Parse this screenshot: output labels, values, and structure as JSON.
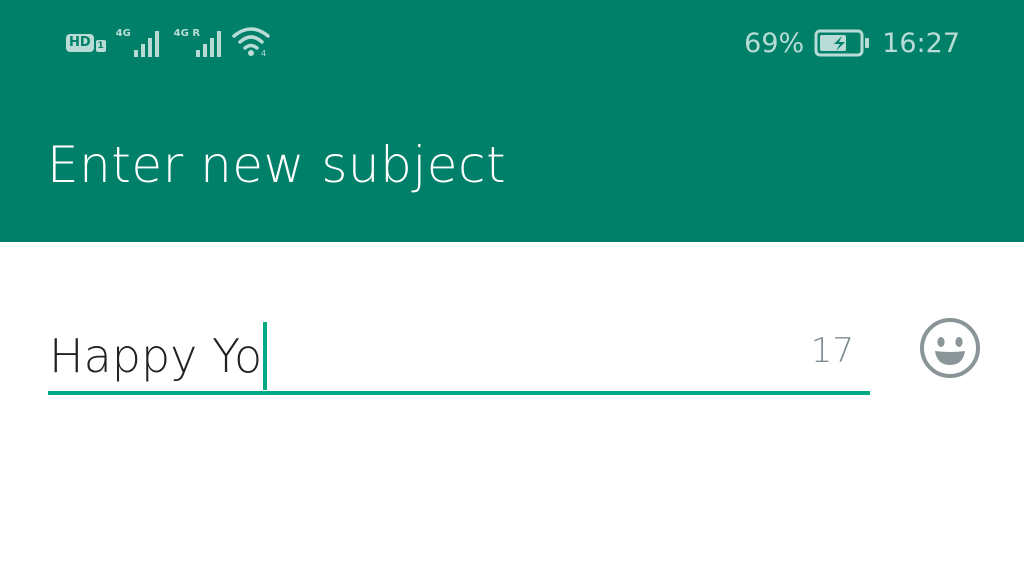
{
  "status_bar": {
    "hd_label": "HD",
    "hd_sub": "1",
    "signal_1_label": "4G",
    "signal_2_label": "4G R",
    "battery_percent": "69%",
    "battery_level": 0.69,
    "time": "16:27"
  },
  "header": {
    "title": "Enter new subject",
    "background_color": "#008069"
  },
  "subject_field": {
    "value": "Happy Yo",
    "remaining_chars": "17",
    "accent_color": "#00a884"
  },
  "icons": {
    "emoji": "smiley-face-icon"
  }
}
